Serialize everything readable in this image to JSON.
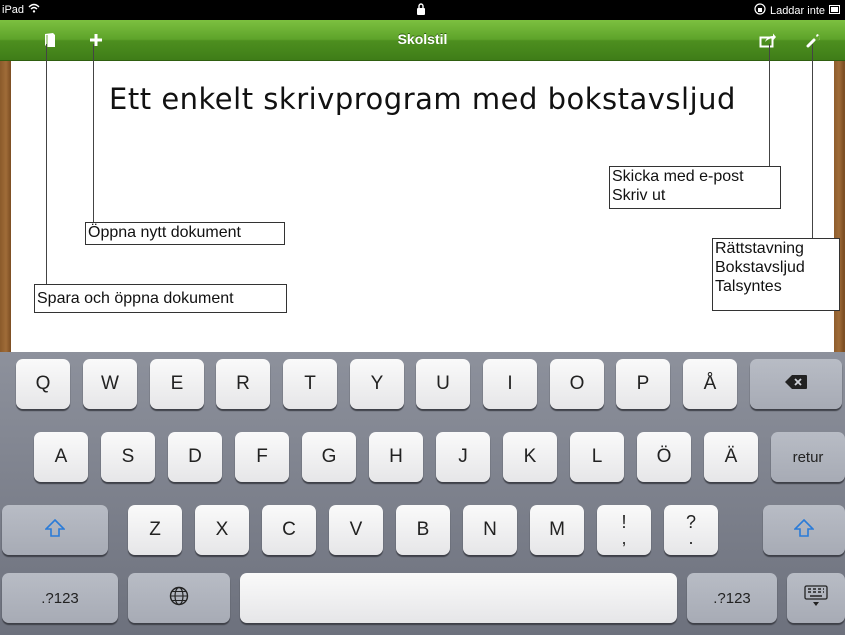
{
  "status": {
    "device": "iPad",
    "charging": "Laddar inte"
  },
  "toolbar": {
    "title": "Skolstil"
  },
  "document": {
    "heading": "Ett enkelt skrivprogram med bokstavsljud"
  },
  "callouts": {
    "email": "Skicka med e-post",
    "print": "Skriv ut",
    "new_doc": "Öppna nytt dokument",
    "spelling": "Rättstavning",
    "letter_sounds": "Bokstavsljud",
    "speech": "Talsyntes",
    "save_open": "Spara och öppna dokument"
  },
  "keyboard": {
    "row1": [
      "Q",
      "W",
      "E",
      "R",
      "T",
      "Y",
      "U",
      "I",
      "O",
      "P",
      "Å"
    ],
    "row2": [
      "A",
      "S",
      "D",
      "F",
      "G",
      "H",
      "J",
      "K",
      "L",
      "Ö",
      "Ä"
    ],
    "row3": [
      "Z",
      "X",
      "C",
      "V",
      "B",
      "N",
      "M"
    ],
    "punct1": [
      "!",
      ","
    ],
    "punct2": [
      "?",
      "."
    ],
    "return_label": "retur",
    "numbers_label": ".?123"
  },
  "icons": {
    "book": "book-icon",
    "add": "plus-icon",
    "share": "share-icon",
    "tools": "wrench-icon",
    "backspace": "backspace-icon",
    "shift": "shift-icon",
    "globe": "globe-icon",
    "hide_keyboard": "keyboard-hide-icon"
  },
  "colors": {
    "toolbar_green": "#5ea32a",
    "shift_blue": "#2a7bd8"
  }
}
